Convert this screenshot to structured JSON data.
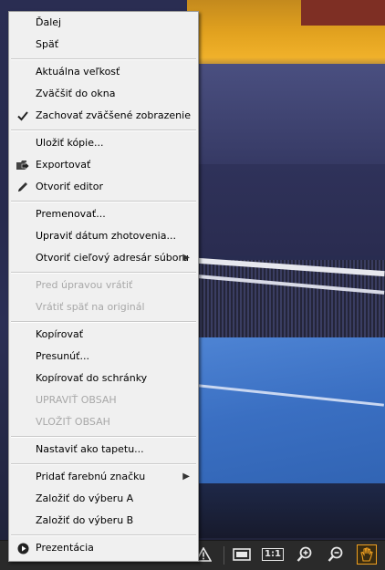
{
  "menu": {
    "next": "Ďalej",
    "back": "Späť",
    "actual_size": "Aktuálna veľkosť",
    "fit_window": "Zväčšiť do okna",
    "keep_zoom": "Zachovať zväčšené zobrazenie",
    "save_copy": "Uložiť kópie...",
    "export": "Exportovať",
    "open_editor": "Otvoriť editor",
    "rename": "Premenovať...",
    "edit_date": "Upraviť dátum zhotovenia...",
    "open_target_folder": "Otvoriť cieľový adresár súboru",
    "revert_before_edit": "Pred úpravou vrátiť",
    "revert_to_original": "Vrátiť späť na originál",
    "copy": "Kopírovať",
    "move": "Presunúť...",
    "copy_to_clipboard": "Kopírovať do schránky",
    "edit_content": "UPRAVIŤ OBSAH",
    "paste_content": "VLOŽIŤ OBSAH",
    "set_wallpaper": "Nastaviť ako tapetu...",
    "add_color_tag": "Pridať farebnú značku",
    "select_a": "Založiť do výberu A",
    "select_b": "Založiť do výberu B",
    "slideshow": "Prezentácia"
  },
  "toolbar": {
    "actual_size_label": "1:1"
  },
  "icons": {
    "check": "check-icon",
    "export": "export-icon",
    "editor": "pencil-icon",
    "slideshow": "play-icon",
    "submenu": "chevron-right-icon"
  },
  "colors": {
    "menu_bg": "#f0f0f0",
    "disabled_text": "#a8a8a8",
    "toolbar_bg": "#2a2a2a",
    "active_tool": "#f0a020"
  }
}
